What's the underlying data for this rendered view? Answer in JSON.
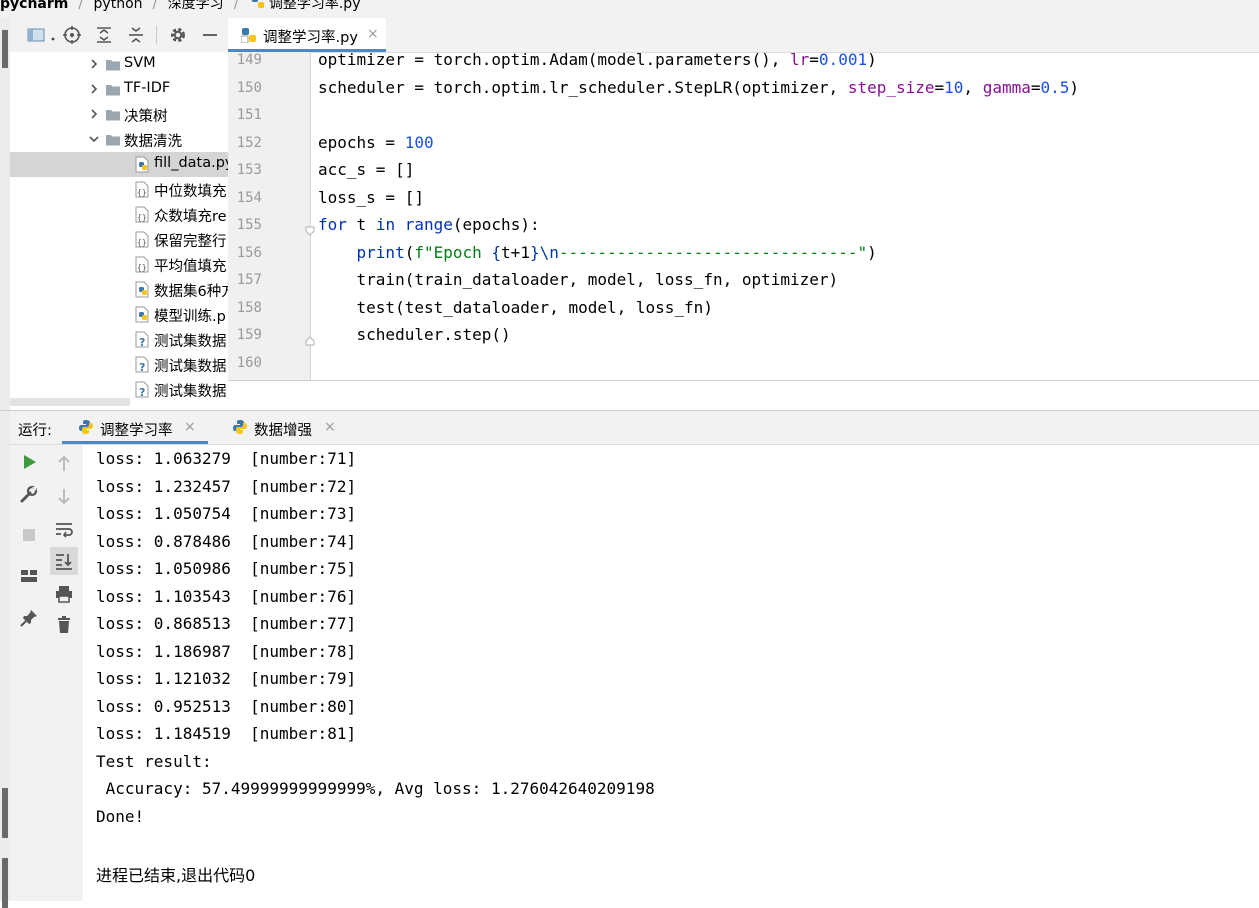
{
  "breadcrumb": {
    "items": [
      "pycharm",
      "python",
      "深度学习",
      "调整学习率.py"
    ]
  },
  "editor": {
    "tab": {
      "label": "调整学习率.py",
      "close": "×"
    },
    "lines": [
      {
        "no": "149",
        "code": "optimizer = torch.optim.Adam(model.parameters(), lr=0.001)"
      },
      {
        "no": "150",
        "code": "scheduler = torch.optim.lr_scheduler.StepLR(optimizer, step_size=10, gamma=0.5)"
      },
      {
        "no": "151",
        "code": ""
      },
      {
        "no": "152",
        "code": "epochs = 100"
      },
      {
        "no": "153",
        "code": "acc_s = []"
      },
      {
        "no": "154",
        "code": "loss_s = []"
      },
      {
        "no": "155",
        "code": "for t in range(epochs):"
      },
      {
        "no": "156",
        "code": "    print(f\"Epoch {t+1}\\n-------------------------------\")"
      },
      {
        "no": "157",
        "code": "    train(train_dataloader, model, loss_fn, optimizer)"
      },
      {
        "no": "158",
        "code": "    test(test_dataloader, model, loss_fn)"
      },
      {
        "no": "159",
        "code": "    scheduler.step()"
      },
      {
        "no": "160",
        "code": ""
      }
    ]
  },
  "project_tree": {
    "items": [
      {
        "label": "SVM",
        "kind": "folder"
      },
      {
        "label": "TF-IDF",
        "kind": "folder"
      },
      {
        "label": "决策树",
        "kind": "folder"
      },
      {
        "label": "数据清洗",
        "kind": "folder-open"
      },
      {
        "label": "fill_data.py",
        "kind": "python-file"
      },
      {
        "label": "中位数填充",
        "kind": "data-file"
      },
      {
        "label": "众数填充re",
        "kind": "data-file"
      },
      {
        "label": "保留完整行",
        "kind": "data-file"
      },
      {
        "label": "平均值填充",
        "kind": "data-file"
      },
      {
        "label": "数据集6种方",
        "kind": "python-file"
      },
      {
        "label": "模型训练.p",
        "kind": "python-file"
      },
      {
        "label": "测试集数据",
        "kind": "unknown-file"
      },
      {
        "label": "测试集数据",
        "kind": "unknown-file"
      },
      {
        "label": "测试集数据",
        "kind": "unknown-file"
      }
    ]
  },
  "run_panel": {
    "title": "运行:",
    "tabs": [
      {
        "label": "调整学习率",
        "close": "×"
      },
      {
        "label": "数据增强",
        "close": "×"
      }
    ],
    "console_lines": [
      "loss: 1.063279  [number:71]",
      "loss: 1.232457  [number:72]",
      "loss: 1.050754  [number:73]",
      "loss: 0.878486  [number:74]",
      "loss: 1.050986  [number:75]",
      "loss: 1.103543  [number:76]",
      "loss: 0.868513  [number:77]",
      "loss: 1.186987  [number:78]",
      "loss: 1.121032  [number:79]",
      "loss: 0.952513  [number:80]",
      "loss: 1.184519  [number:81]",
      "Test result:",
      " Accuracy: 57.49999999999999%, Avg loss: 1.276042640209198",
      "Done!",
      ""
    ],
    "exit_message": "进程已结束,退出代码0"
  },
  "colors": {
    "keyword": "#0033b3",
    "number": "#1750eb",
    "param": "#871094",
    "string": "#067d17",
    "accent": "#4a88c7",
    "run_green": "#3f9a3f"
  }
}
